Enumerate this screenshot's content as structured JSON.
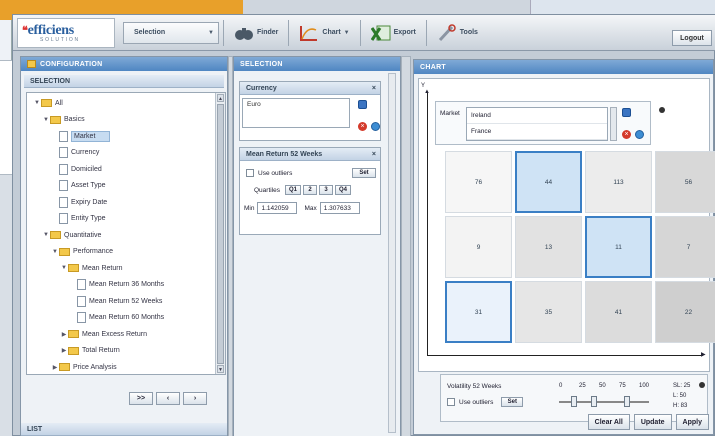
{
  "toolbar": {
    "logo": "efficiens",
    "logo_sub": "SOLUTION",
    "selection_label": "Selection",
    "finder_label": "Finder",
    "chart_label": "Chart",
    "export_label": "Export",
    "tools_label": "Tools",
    "logout_label": "Logout"
  },
  "config": {
    "title": "CONFIGURATION",
    "section": "SELECTION",
    "list_title": "LIST",
    "tree": [
      {
        "label": "All",
        "type": "folder",
        "indent": 0,
        "twisty": "▼"
      },
      {
        "label": "Basics",
        "type": "folder",
        "indent": 1,
        "twisty": "▼"
      },
      {
        "label": "Market",
        "type": "doc",
        "indent": 2,
        "twisty": "",
        "selected": true
      },
      {
        "label": "Currency",
        "type": "doc",
        "indent": 2,
        "twisty": ""
      },
      {
        "label": "Domiciled",
        "type": "doc",
        "indent": 2,
        "twisty": ""
      },
      {
        "label": "Asset Type",
        "type": "doc",
        "indent": 2,
        "twisty": ""
      },
      {
        "label": "Expiry Date",
        "type": "doc",
        "indent": 2,
        "twisty": ""
      },
      {
        "label": "Entity Type",
        "type": "doc",
        "indent": 2,
        "twisty": ""
      },
      {
        "label": "Quantitative",
        "type": "folder",
        "indent": 1,
        "twisty": "▼"
      },
      {
        "label": "Performance",
        "type": "folder",
        "indent": 2,
        "twisty": "▼"
      },
      {
        "label": "Mean Return",
        "type": "folder",
        "indent": 3,
        "twisty": "▼"
      },
      {
        "label": "Mean Return 36 Months",
        "type": "doc",
        "indent": 4,
        "twisty": ""
      },
      {
        "label": "Mean Return 52 Weeks",
        "type": "doc",
        "indent": 4,
        "twisty": ""
      },
      {
        "label": "Mean Return 60 Months",
        "type": "doc",
        "indent": 4,
        "twisty": ""
      },
      {
        "label": "Mean Excess Return",
        "type": "folder",
        "indent": 3,
        "twisty": "▶"
      },
      {
        "label": "Total Return",
        "type": "folder",
        "indent": 3,
        "twisty": "▶"
      },
      {
        "label": "Price Analysis",
        "type": "folder",
        "indent": 2,
        "twisty": "▶"
      }
    ],
    "nav_buttons": [
      ">>",
      "‹",
      "›"
    ]
  },
  "selection": {
    "title": "SELECTION",
    "currency_header": "Currency",
    "currency_value": "Euro",
    "mean_header": "Mean Return 52 Weeks",
    "use_outliers": "Use outliers",
    "set_label": "Set",
    "quartiles_label": "Quartiles",
    "quartile_buttons": [
      "Q1",
      "2",
      "3",
      "Q4"
    ],
    "min_label": "Min",
    "min_value": "1.142059",
    "max_label": "Max",
    "max_value": "1.307633"
  },
  "chart": {
    "title": "CHART",
    "y_axis_tick": "Y",
    "market_label": "Market",
    "markets": [
      "Ireland",
      "France"
    ],
    "cells": [
      [
        "76",
        "44",
        "113",
        "56"
      ],
      [
        "9",
        "13",
        "11",
        "7"
      ],
      [
        "31",
        "35",
        "41",
        "22"
      ]
    ],
    "highlighted": [
      [
        0,
        1
      ],
      [
        1,
        2
      ],
      [
        2,
        0
      ]
    ],
    "volatility_label": "Volatility 52 Weeks",
    "use_outliers": "Use outliers",
    "set_label": "Set",
    "scale": [
      "0",
      "25",
      "50",
      "75",
      "100"
    ],
    "stats": [
      "SL: 25",
      "L: 50",
      "H: 83"
    ],
    "clear_all": "Clear All",
    "update": "Update",
    "apply": "Apply"
  },
  "colors": {
    "accent": "#3a7fc5",
    "header": "#4f86c2",
    "brand_orange": "#e8a02a"
  }
}
